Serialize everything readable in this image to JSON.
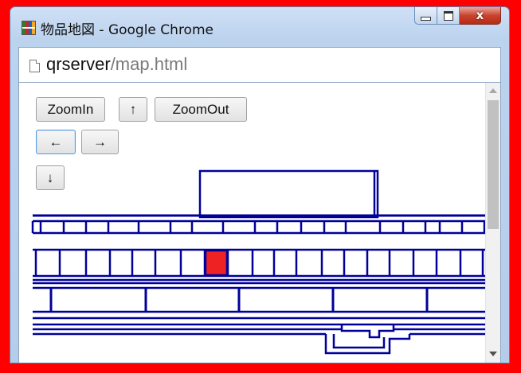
{
  "window": {
    "title": "物品地図 - Google Chrome",
    "minimize_glyph": "",
    "close_glyph": "x"
  },
  "address": {
    "host": "qrserver",
    "path": "/map.html"
  },
  "controls": {
    "zoom_in": "ZoomIn",
    "up": "↑",
    "zoom_out": "ZoomOut",
    "left": "←",
    "right": "→",
    "down": "↓"
  },
  "map": {
    "line_color": "#000099",
    "highlight_color": "#ee2222"
  },
  "colors": {
    "frame_red": "#ff0000"
  }
}
